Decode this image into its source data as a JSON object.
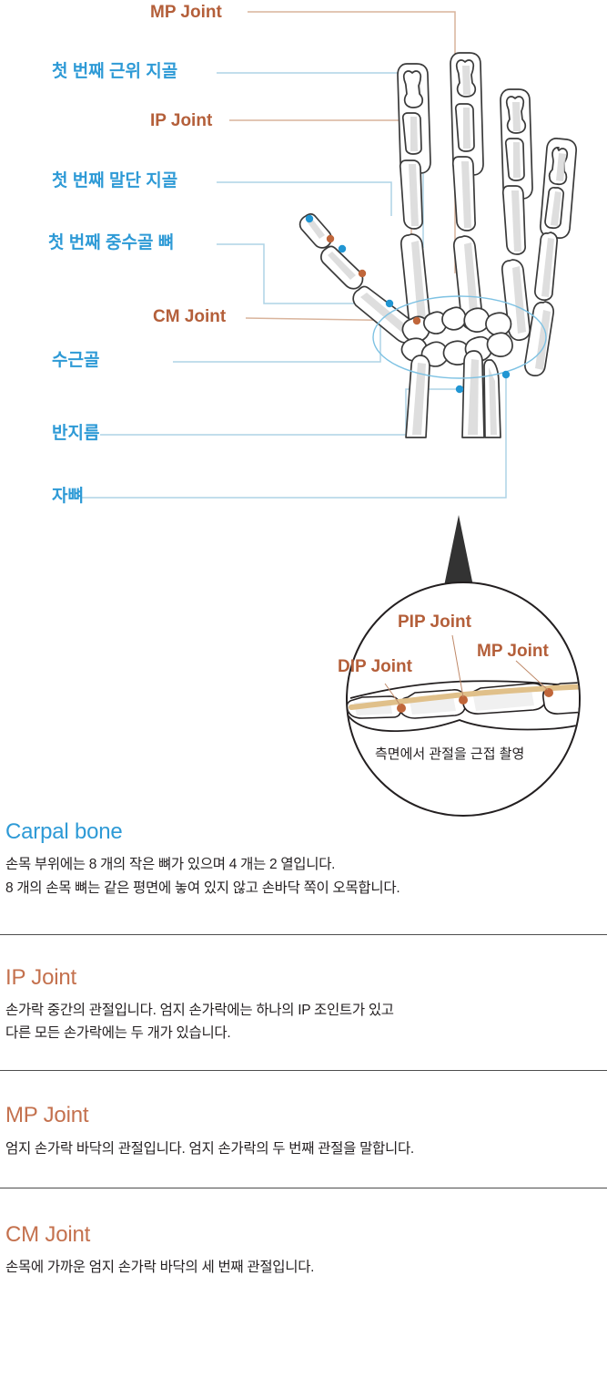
{
  "colors": {
    "label_blue": "#2e9ad6",
    "label_orange": "#b45f3a",
    "heading_blue": "#2e9ad6",
    "heading_orange": "#c4714e",
    "leader_blue": "#aed4e6",
    "leader_orange": "#d9b49c",
    "dot_blue": "#2196d3",
    "dot_orange": "#c0663a",
    "bone_outline": "#3a3a3a",
    "bone_fill": "#ffffff",
    "tendon_tan": "#e0c08a",
    "pointer_dark": "#333333",
    "divider": "#4d4d4d"
  },
  "diagram": {
    "labels": [
      {
        "id": "mp-joint",
        "text": "MP Joint",
        "color": "orange"
      },
      {
        "id": "first-proximal-phalanx",
        "text": "첫 번째 근위 지골",
        "color": "blue"
      },
      {
        "id": "ip-joint",
        "text": "IP Joint",
        "color": "orange"
      },
      {
        "id": "first-distal-phalanx",
        "text": "첫 번째 말단 지골",
        "color": "blue"
      },
      {
        "id": "first-metacarpal-bone",
        "text": "첫 번째 중수골 뼈",
        "color": "blue"
      },
      {
        "id": "cm-joint",
        "text": "CM Joint",
        "color": "orange"
      },
      {
        "id": "carpal-bones",
        "text": "수근골",
        "color": "blue"
      },
      {
        "id": "radius",
        "text": "반지름",
        "color": "blue"
      },
      {
        "id": "ulna",
        "text": "자뼈",
        "color": "blue"
      }
    ]
  },
  "magnifier": {
    "labels": [
      {
        "id": "dip-joint",
        "text": "DIP Joint"
      },
      {
        "id": "pip-joint",
        "text": "PIP Joint"
      },
      {
        "id": "mp-joint",
        "text": "MP Joint"
      }
    ],
    "caption": "측면에서 관절을 근접 촬영"
  },
  "sections": [
    {
      "id": "carpal-bone",
      "heading": "Carpal bone",
      "heading_color": "blue",
      "lines": [
        "손목 부위에는 8 개의 작은 뼈가 있으며 4 개는 2 열입니다.",
        "8 개의 손목 뼈는 같은 평면에 놓여 있지 않고 손바닥 쪽이 오목합니다."
      ]
    },
    {
      "id": "ip-joint",
      "heading": "IP Joint",
      "heading_color": "orange",
      "lines": [
        "손가락 중간의 관절입니다. 엄지 손가락에는 하나의 IP 조인트가 있고",
        "다른 모든 손가락에는 두 개가 있습니다."
      ]
    },
    {
      "id": "mp-joint",
      "heading": "MP Joint",
      "heading_color": "orange",
      "lines": [
        "엄지 손가락 바닥의 관절입니다. 엄지 손가락의 두 번째 관절을 말합니다."
      ]
    },
    {
      "id": "cm-joint",
      "heading": "CM Joint",
      "heading_color": "orange",
      "lines": [
        "손목에 가까운 엄지 손가락 바닥의 세 번째 관절입니다."
      ]
    }
  ]
}
